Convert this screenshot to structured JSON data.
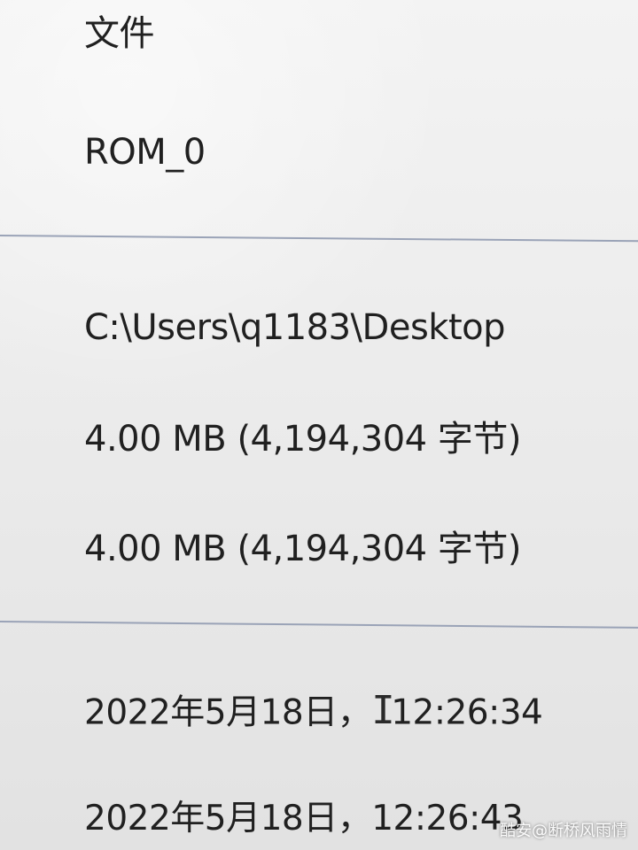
{
  "properties": {
    "type_label": "文件",
    "name": "ROM_0",
    "location": "C:\\Users\\q1183\\Desktop",
    "size": "4.00 MB (4,194,304 字节)",
    "size_on_disk": "4.00 MB (4,194,304 字节)",
    "created_date": "2022年5月18日，",
    "created_time": "12:26:34",
    "modified": "2022年5月18日，12:26:43"
  },
  "cursor_glyph": "I",
  "watermark": "酷安@断桥风雨情"
}
